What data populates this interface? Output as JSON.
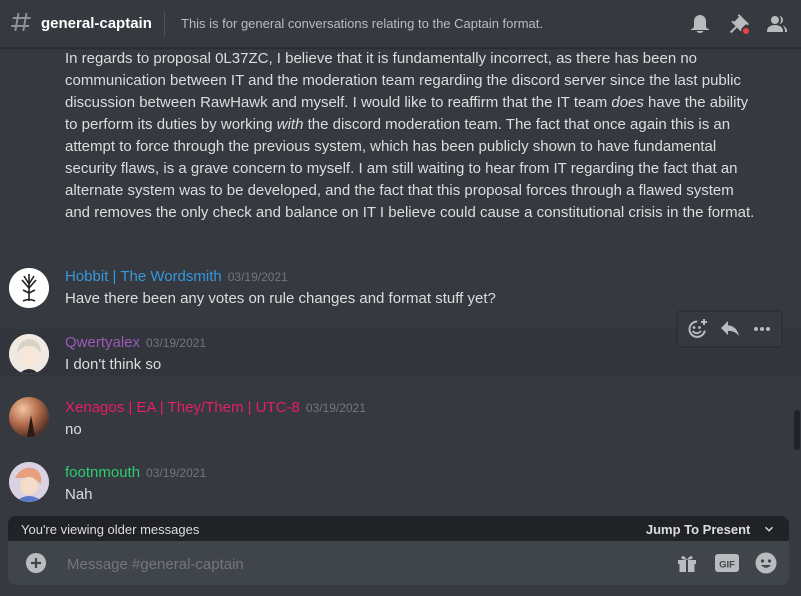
{
  "header": {
    "channel_name": "general-captain",
    "topic": "This is for general conversations relating to the Captain format."
  },
  "continued_message": {
    "text_1": "In regards to proposal 0L37ZC, I believe that it is fundamentally incorrect, as there has been no communication between IT and the moderation team regarding the discord server since the last public discussion between RawHawk and myself. I would like to reaffirm that the IT team ",
    "em_1": "does",
    "text_2": " have the ability to perform its duties by working ",
    "em_2": "with",
    "text_3": " the discord moderation team. The fact that once again this is an attempt to force through the previous system, which has been publicly shown to have fundamental security flaws, is a grave concern to myself. I am still waiting to hear from IT regarding the fact that an alternate system was to be developed, and the fact that this proposal forces through a flawed system and removes the only check and balance on IT I believe could cause a constitutional crisis in the format."
  },
  "messages": [
    {
      "author": "Hobbit | The Wordsmith",
      "timestamp": "03/19/2021",
      "text": "Have there been any votes on rule changes and format stuff yet?",
      "color": "#3498db"
    },
    {
      "author": "Qwertyalex",
      "timestamp": "03/19/2021",
      "text": "I don't think so",
      "color": "#9b59b6"
    },
    {
      "author": "Xenagos | EA | They/Them | UTC-8",
      "timestamp": "03/19/2021",
      "text": "no",
      "color": "#e91e63"
    },
    {
      "author": "footnmouth",
      "timestamp": "03/19/2021",
      "text": "Nah",
      "color": "#2ecc71"
    }
  ],
  "older_bar": {
    "text": "You're viewing older messages",
    "jump_label": "Jump To Present"
  },
  "composer": {
    "placeholder": "Message #general-captain"
  },
  "icons": {
    "header": [
      "hashtag-icon",
      "bell-icon",
      "pin-icon",
      "members-icon"
    ],
    "toolbar": [
      "add-reaction-icon",
      "reply-icon",
      "more-icon"
    ],
    "composer": [
      "plus-icon",
      "gift-icon",
      "gif-icon",
      "emoji-icon"
    ]
  },
  "colors": {
    "background": "#36393f",
    "pin_badge": "#ed4245"
  }
}
